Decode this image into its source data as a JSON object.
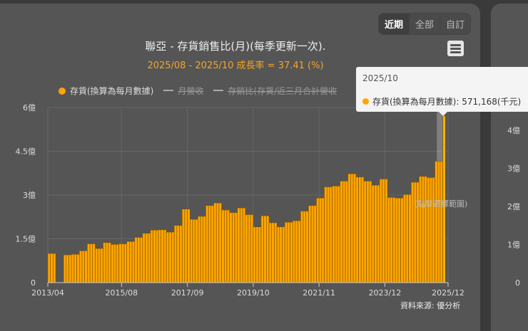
{
  "range_buttons": [
    "近期",
    "全部",
    "自訂"
  ],
  "title": "聯亞 - 存貨銷售比(月)(每季更新一次).",
  "subtitle": "2025/08 - 2025/10 成長率 = 37.41 (%)",
  "legend": [
    {
      "label": "存貨(換算為每月數據)",
      "visible": true
    },
    {
      "label": "月營收",
      "visible": false
    },
    {
      "label": "存銷比(存貨/近三月合計營收",
      "visible": false
    }
  ],
  "tooltip": {
    "date": "2025/10",
    "series": "存貨(換算為每月數據)",
    "value": "571,168(千元)"
  },
  "zoom_hint": "(點擊選擇範圍)",
  "source": "資料來源: 優分析",
  "right_panel_yticks": [
    "4億",
    "3億",
    "2億",
    "1億",
    "0"
  ],
  "colors": {
    "bar": "#ffa500",
    "background": "#555555",
    "accent": "#f5a623"
  },
  "chart_data": {
    "type": "bar",
    "unit": "億 (TWD 100M)",
    "start_month": "2013/04",
    "yticks": [
      "0",
      "1.5億",
      "3億",
      "4.5億",
      "6億"
    ],
    "ylim": [
      0,
      6
    ],
    "xticks": [
      "2013/04",
      "2015/08",
      "2017/09",
      "2019/10",
      "2021/11",
      "2023/12",
      "2025/12"
    ],
    "quarterly_values_from_start": [
      1.0,
      0,
      0.95,
      0.97,
      1.09,
      1.33,
      1.17,
      1.37,
      1.31,
      1.33,
      1.41,
      1.55,
      1.69,
      1.8,
      1.81,
      1.73,
      1.96,
      2.52,
      2.17,
      2.27,
      2.64,
      2.73,
      2.49,
      2.4,
      2.56,
      2.33,
      1.91,
      2.29,
      2.05,
      1.91,
      2.07,
      2.12,
      2.45,
      2.64,
      2.9,
      3.28,
      3.31,
      3.48,
      3.73,
      3.62,
      3.48,
      3.34,
      3.55,
      2.92,
      2.9,
      3.02,
      3.44,
      3.64,
      3.6,
      4.16
    ],
    "last_month": {
      "label": "2025/10",
      "value": 5.71168
    }
  }
}
